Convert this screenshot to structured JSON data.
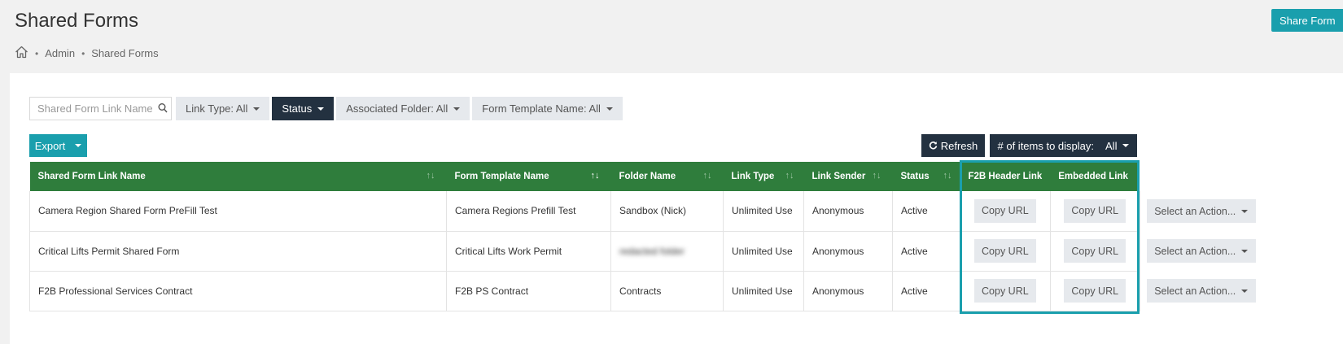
{
  "page": {
    "title": "Shared Forms",
    "share_button": "Share Form"
  },
  "breadcrumb": {
    "items": [
      "Admin",
      "Shared Forms"
    ]
  },
  "filters": {
    "search_placeholder": "Shared Form Link Name",
    "link_type": "Link Type: All",
    "status": "Status",
    "associated_folder": "Associated Folder: All",
    "form_template": "Form Template Name: All"
  },
  "toolbar": {
    "export": "Export",
    "refresh": "Refresh",
    "items_label": "# of items to display:",
    "items_value": "All"
  },
  "table": {
    "headers": [
      "Shared Form Link Name",
      "Form Template Name",
      "Folder Name",
      "Link Type",
      "Link Sender",
      "Status",
      "F2B Header Link",
      "Embedded Link"
    ],
    "copy_label": "Copy URL",
    "action_label": "Select an Action...",
    "rows": [
      [
        "Camera Region Shared Form PreFill Test",
        "Camera Regions Prefill Test",
        "Sandbox (Nick)",
        "Unlimited Use",
        "Anonymous",
        "Active"
      ],
      [
        "Critical Lifts Permit Shared Form",
        "Critical Lifts Work Permit",
        "redacted folder",
        "Unlimited Use",
        "Anonymous",
        "Active"
      ],
      [
        "F2B Professional Services Contract",
        "F2B PS Contract",
        "Contracts",
        "Unlimited Use",
        "Anonymous",
        "Active"
      ]
    ]
  },
  "colors": {
    "accent": "#1a9fad",
    "dark": "#233140",
    "header_green": "#2f7d3c"
  }
}
